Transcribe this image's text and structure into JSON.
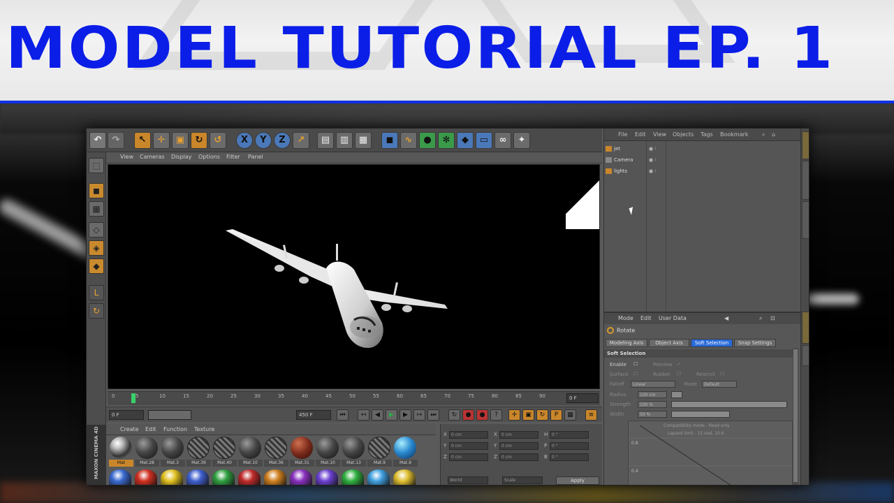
{
  "banner": {
    "title": "MODEL TUTORIAL EP. 1"
  },
  "toolbar": {
    "icons": [
      "undo-icon",
      "redo-icon",
      "select-icon",
      "move-icon",
      "scale-icon",
      "rotate-icon",
      "live-select-icon",
      "x-axis-icon",
      "y-axis-icon",
      "z-axis-icon",
      "world-coords-icon",
      "render-view-icon",
      "render-pv-icon",
      "render-settings-icon",
      "cube-icon",
      "spline-icon",
      "nurbs-icon",
      "array-icon",
      "deformer-icon",
      "floor-icon",
      "camera-icon",
      "light-icon"
    ],
    "axis_x": "X",
    "axis_y": "Y",
    "axis_z": "Z"
  },
  "viewport_menu": {
    "items": [
      "View",
      "Cameras",
      "Display",
      "Options",
      "Filter",
      "Panel"
    ]
  },
  "timeline": {
    "ticks": [
      "0",
      "5",
      "10",
      "15",
      "20",
      "25",
      "30",
      "35",
      "40",
      "45",
      "50",
      "55",
      "60",
      "65",
      "70",
      "75",
      "80",
      "85",
      "90"
    ],
    "current_frame": "0 F"
  },
  "transport": {
    "start_field": "0 F",
    "end_field": "450 F"
  },
  "materials": {
    "menu": [
      "Create",
      "Edit",
      "Function",
      "Texture"
    ],
    "brand": "MAXON CINEMA 4D",
    "items": [
      {
        "name": "Mat",
        "style": "chrome",
        "selected": true
      },
      {
        "name": "Mat.28",
        "style": "dark"
      },
      {
        "name": "Mat.3",
        "style": "dark"
      },
      {
        "name": "Mat.39",
        "style": "tex"
      },
      {
        "name": "Mat.40",
        "style": "tex"
      },
      {
        "name": "Mat.10",
        "style": "dark"
      },
      {
        "name": "Mat.36",
        "style": "tex"
      },
      {
        "name": "Mat.31",
        "style": "red"
      },
      {
        "name": "Mat.10",
        "style": "dark"
      },
      {
        "name": "Mat.13",
        "style": "dark"
      },
      {
        "name": "Mat.9",
        "style": "tex"
      },
      {
        "name": "Mat.9",
        "style": "blue"
      }
    ],
    "row2_colors": [
      "#3a6ad0",
      "#d03020",
      "#e0c020",
      "#4060d0",
      "#30a040",
      "#c02a2a",
      "#d08020",
      "#8a30c0",
      "#6a40d0",
      "#30b040",
      "#40a0e0",
      "#e0c030"
    ]
  },
  "coordinates": {
    "rows": [
      {
        "a": "X",
        "av": "0 cm",
        "b": "X",
        "bv": "0 cm",
        "c": "H",
        "cv": "0 °"
      },
      {
        "a": "Y",
        "av": "0 cm",
        "b": "Y",
        "bv": "0 cm",
        "c": "P",
        "cv": "0 °"
      },
      {
        "a": "Z",
        "av": "0 cm",
        "b": "Z",
        "bv": "0 cm",
        "c": "B",
        "cv": "0 °"
      }
    ],
    "mode": "World",
    "scale_mode": "Scale",
    "apply": "Apply"
  },
  "object_manager": {
    "menu": [
      "File",
      "Edit",
      "View",
      "Objects",
      "Tags",
      "Bookmark"
    ],
    "objects": [
      {
        "name": "jet",
        "icon": "null-object-icon"
      },
      {
        "name": "Camera",
        "icon": "camera-icon"
      },
      {
        "name": "lights",
        "icon": "null-object-icon"
      }
    ]
  },
  "attribute_manager": {
    "menu": [
      "Mode",
      "Edit",
      "User Data"
    ],
    "tool": "Rotate",
    "tabs": [
      "Modeling Axis",
      "Object Axis",
      "Soft Selection",
      "Snap Settings"
    ],
    "active_tab": "Soft Selection",
    "section": "Soft Selection",
    "enable": "Enable",
    "preview": "Preview",
    "surface": "Surface",
    "rubber": "Rubber",
    "restrict": "Restrict",
    "falloff": "Falloff",
    "falloff_val": "Linear",
    "mode": "Mode",
    "mode_val": "Default",
    "radius": "Radius",
    "radius_val": "100 cm",
    "strength": "Strength",
    "strength_val": "100 %",
    "width": "Width",
    "width_val": "50 %",
    "graph_line1": "Compatibility mode - Read only",
    "graph_line2": "Lapsed limit - 15 real. 10.6",
    "graph_y1": "0.8",
    "graph_y2": "0.4"
  },
  "colors": {
    "accent": "#1030e6",
    "selection": "#2a6ad8",
    "active_orange": "#c9862a"
  }
}
